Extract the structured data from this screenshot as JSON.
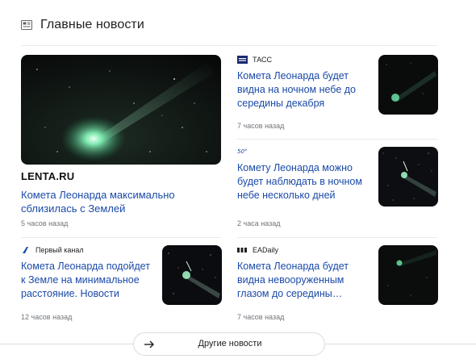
{
  "header": {
    "title": "Главные новости"
  },
  "featured": {
    "source": "LENTA.RU",
    "title": "Комета Леонарда максимально сблизилась с Землей",
    "time": "5 часов назад"
  },
  "right_cards": [
    {
      "source": "ТАСС",
      "title": "Комета Леонарда будет видна на ночном небе до середины декабря",
      "time": "7 часов назад"
    },
    {
      "source": "",
      "title": "Комету Леонарда можно будет наблюдать в ночном небе несколько дней",
      "time": "2 часа назад"
    },
    {
      "source": "EADaily",
      "title": "Комета Леонарда будет видна невооруженным глазом до середины…",
      "time": "7 часов назад"
    }
  ],
  "left_card": {
    "source": "Первый канал",
    "title": "Комета Леонарда подойдет к Земле на минимальное расстояние. Новости",
    "time": "12 часов назад"
  },
  "more_button": {
    "label": "Другие новости"
  },
  "colors": {
    "link": "#1a4aa8",
    "muted": "#70757a",
    "divider": "#e8eaed"
  }
}
